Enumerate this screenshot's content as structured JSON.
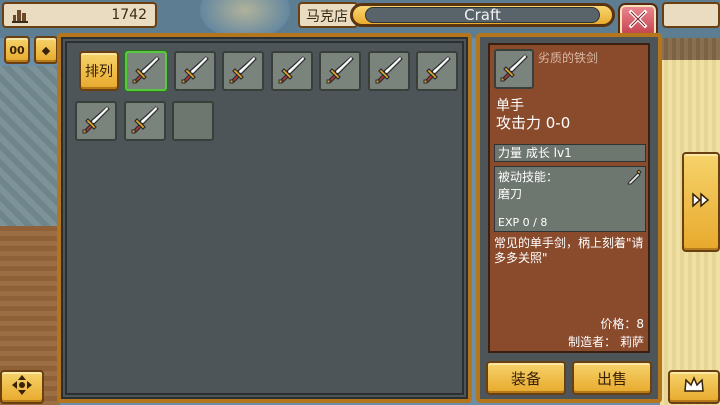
{
  "hud": {
    "money": "1742",
    "location_name": "马克店",
    "window_title": "Craft"
  },
  "left_buttons": {
    "top_a": "00",
    "top_b": "◆"
  },
  "inventory": {
    "sort_label": "排列",
    "slots": [
      {
        "item": "sword-icon",
        "selected": true
      },
      {
        "item": "sword-icon",
        "selected": false
      },
      {
        "item": "sword-icon",
        "selected": false
      },
      {
        "item": "sword-icon",
        "selected": false
      },
      {
        "item": "sword-icon",
        "selected": false
      },
      {
        "item": "sword-icon",
        "selected": false
      },
      {
        "item": "sword-icon",
        "selected": false
      },
      {
        "item": "sword-icon",
        "selected": false
      },
      {
        "item": "sword-icon",
        "selected": false
      },
      {
        "item": "",
        "selected": false
      }
    ]
  },
  "detail": {
    "name": "劣质的铁剑",
    "hand": "单手",
    "attack": "攻击力 0-0",
    "stat": "力量 成长 lv1",
    "skill_title": "被动技能：",
    "skill_name": "磨刀",
    "exp": "EXP 0 / 8",
    "description": "常见的单手剑，柄上刻着\"请多多关照\"",
    "price": "价格：8",
    "maker": "制造者： 莉萨",
    "equip_label": "装备",
    "sell_label": "出售"
  },
  "colors": {
    "accent_gold": "#e7a92c",
    "panel_border": "#b4761c",
    "detail_bg": "#8a4a2c",
    "selected_border": "#57c93e",
    "close_red": "#c4414d"
  }
}
